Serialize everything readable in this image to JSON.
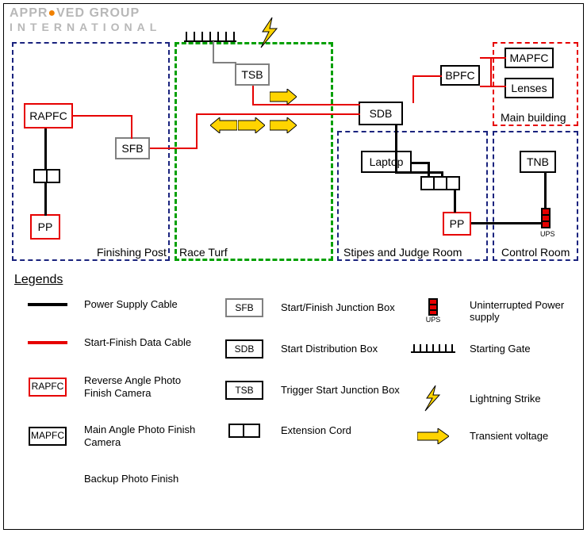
{
  "logo": {
    "line1_a": "APPR",
    "line1_b": "VED GROUP",
    "line2": "INTERNATIONAL"
  },
  "zones": {
    "finishing_post": "Finishing Post",
    "race_turf": "Race Turf",
    "stipes_judge": "Stipes and Judge Room",
    "control_room": "Control Room",
    "main_building": "Main building"
  },
  "nodes": {
    "rapfc": "RAPFC",
    "sfb": "SFB",
    "pp1": "PP",
    "tsb": "TSB",
    "sdb": "SDB",
    "laptop": "Laptop",
    "pp2": "PP",
    "bpfc": "BPFC",
    "mapfc": "MAPFC",
    "lenses": "Lenses",
    "tnb": "TNB",
    "ups": "UPS"
  },
  "legend_title": "Legends",
  "legend": {
    "power_cable": "Power Supply Cable",
    "data_cable": "Start-Finish Data Cable",
    "rapfc": "Reverse Angle Photo Finish Camera",
    "mapfc": "Main Angle Photo Finish Camera",
    "bpfc": "Backup Photo Finish",
    "sfb": "Start/Finish Junction Box",
    "sdb": "Start Distribution Box",
    "tsb": "Trigger Start Junction Box",
    "ext": "Extension Cord",
    "ups": "Uninterrupted Power supply",
    "gate": "Starting Gate",
    "lightning": "Lightning Strike",
    "transient": "Transient voltage"
  },
  "leg_sym": {
    "rapfc": "RAPFC",
    "mapfc": "MAPFC",
    "sfb": "SFB",
    "sdb": "SDB",
    "tsb": "TSB",
    "ups": "UPS"
  }
}
